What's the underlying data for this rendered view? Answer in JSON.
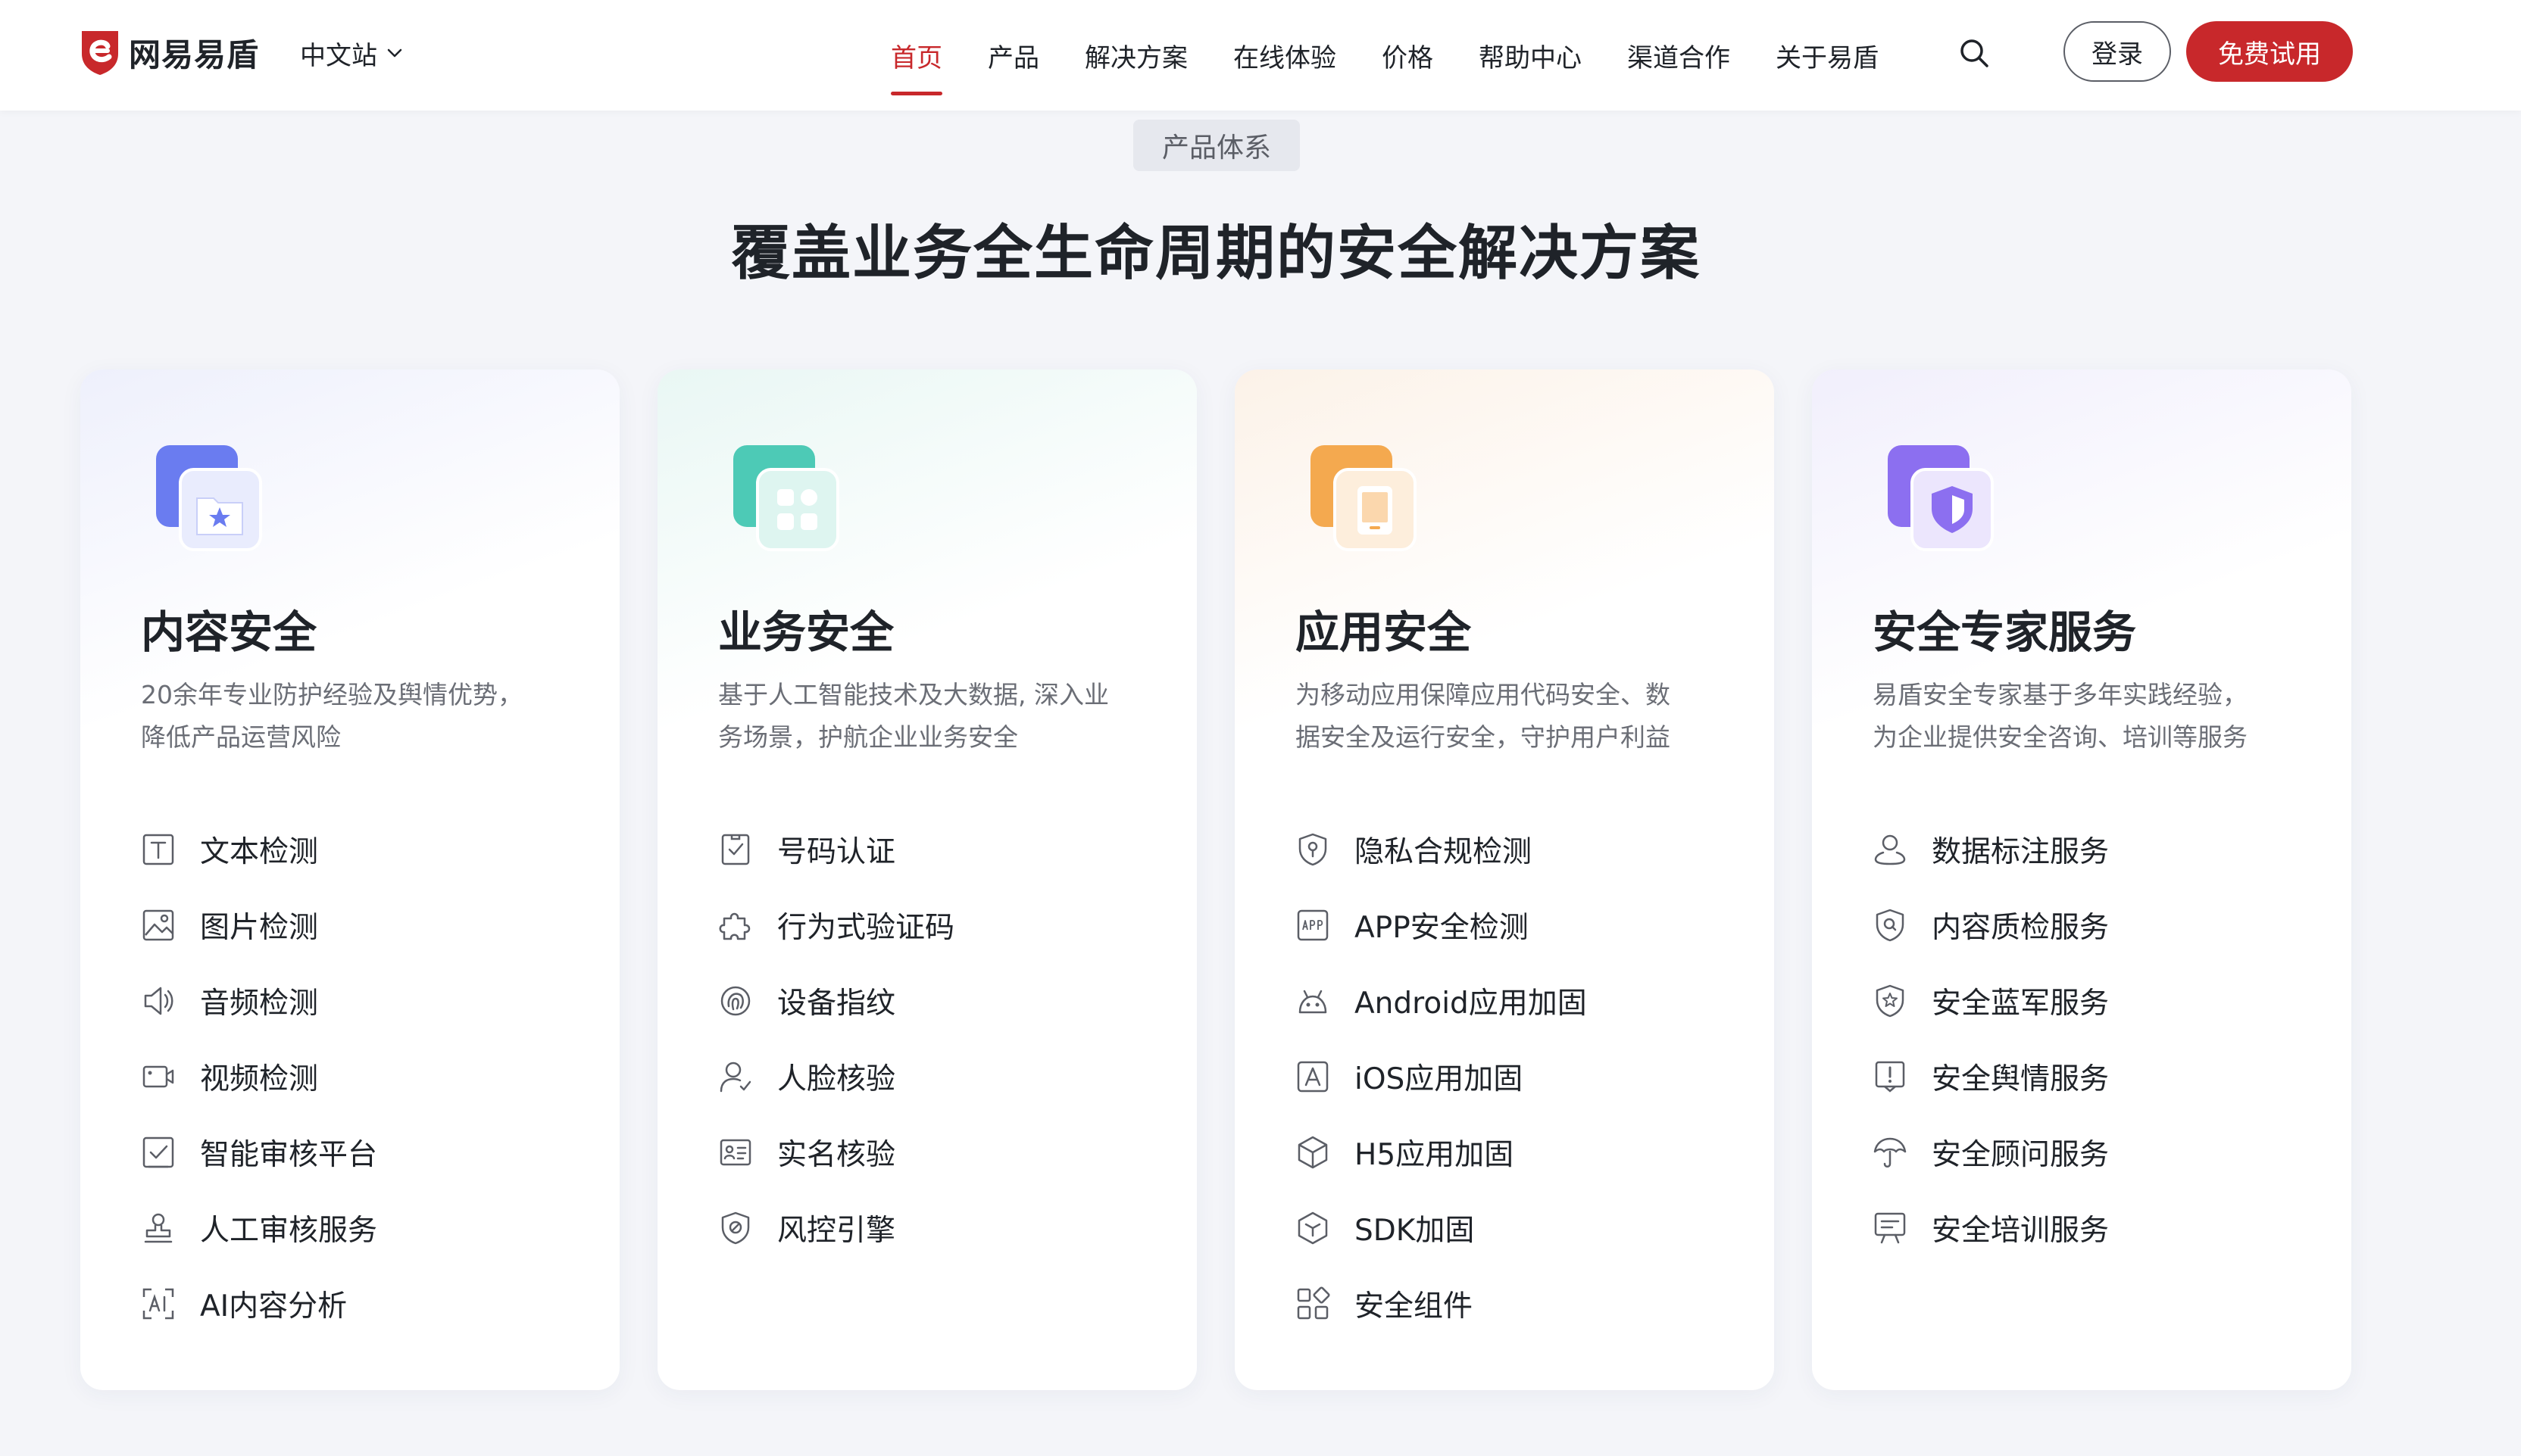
{
  "header": {
    "logo_text": "网易易盾",
    "region": "中文站",
    "nav": [
      "首页",
      "产品",
      "解决方案",
      "在线体验",
      "价格",
      "帮助中心",
      "渠道合作",
      "关于易盾"
    ],
    "active_nav": 0,
    "login_label": "登录",
    "trial_label": "免费试用"
  },
  "section": {
    "tag": "产品体系",
    "title": "覆盖业务全生命周期的安全解决方案"
  },
  "colors": {
    "brand_red": "#c8282b",
    "content_blue": "#6a7cf0",
    "business_teal": "#4dcab6",
    "app_orange": "#f4a94f",
    "expert_purple": "#8c6ff0"
  },
  "cards": [
    {
      "title": "内容安全",
      "desc_lines": [
        "20余年专业防护经验及舆情优势，",
        "降低产品运营风险"
      ],
      "icon": "folder-star-icon",
      "items": [
        {
          "label": "文本检测",
          "icon": "text-icon"
        },
        {
          "label": "图片检测",
          "icon": "image-icon"
        },
        {
          "label": "音频检测",
          "icon": "speaker-icon"
        },
        {
          "label": "视频检测",
          "icon": "video-icon"
        },
        {
          "label": "智能审核平台",
          "icon": "check-square-icon"
        },
        {
          "label": "人工审核服务",
          "icon": "stamp-icon"
        },
        {
          "label": "AI内容分析",
          "icon": "ai-scan-icon"
        }
      ]
    },
    {
      "title": "业务安全",
      "desc_lines": [
        "基于人工智能技术及大数据, 深入业",
        "务场景，护航企业业务安全"
      ],
      "icon": "apps-icon",
      "items": [
        {
          "label": "号码认证",
          "icon": "number-verify-icon"
        },
        {
          "label": "行为式验证码",
          "icon": "puzzle-icon"
        },
        {
          "label": "设备指纹",
          "icon": "fingerprint-icon"
        },
        {
          "label": "人脸核验",
          "icon": "face-user-icon"
        },
        {
          "label": "实名核验",
          "icon": "id-card-icon"
        },
        {
          "label": "风控引擎",
          "icon": "shield-engine-icon"
        }
      ]
    },
    {
      "title": "应用安全",
      "desc_lines": [
        "为移动应用保障应用代码安全、数",
        "据安全及运行安全，守护用户利益"
      ],
      "icon": "tablet-icon",
      "items": [
        {
          "label": "隐私合规检测",
          "icon": "privacy-shield-icon"
        },
        {
          "label": "APP安全检测",
          "icon": "app-badge-icon"
        },
        {
          "label": "Android应用加固",
          "icon": "android-icon"
        },
        {
          "label": "iOS应用加固",
          "icon": "ios-icon"
        },
        {
          "label": "H5应用加固",
          "icon": "cube-icon"
        },
        {
          "label": "SDK加固",
          "icon": "hexagon-icon"
        },
        {
          "label": "安全组件",
          "icon": "components-icon"
        }
      ]
    },
    {
      "title": "安全专家服务",
      "desc_lines": [
        "易盾安全专家基于多年实践经验，",
        "为企业提供安全咨询、培训等服务"
      ],
      "icon": "shield-user-icon",
      "items": [
        {
          "label": "数据标注服务",
          "icon": "user-pin-icon"
        },
        {
          "label": "内容质检服务",
          "icon": "shield-search-icon"
        },
        {
          "label": "安全蓝军服务",
          "icon": "shield-star-icon"
        },
        {
          "label": "安全舆情服务",
          "icon": "alert-icon"
        },
        {
          "label": "安全顾问服务",
          "icon": "umbrella-icon"
        },
        {
          "label": "安全培训服务",
          "icon": "training-board-icon"
        }
      ]
    }
  ]
}
